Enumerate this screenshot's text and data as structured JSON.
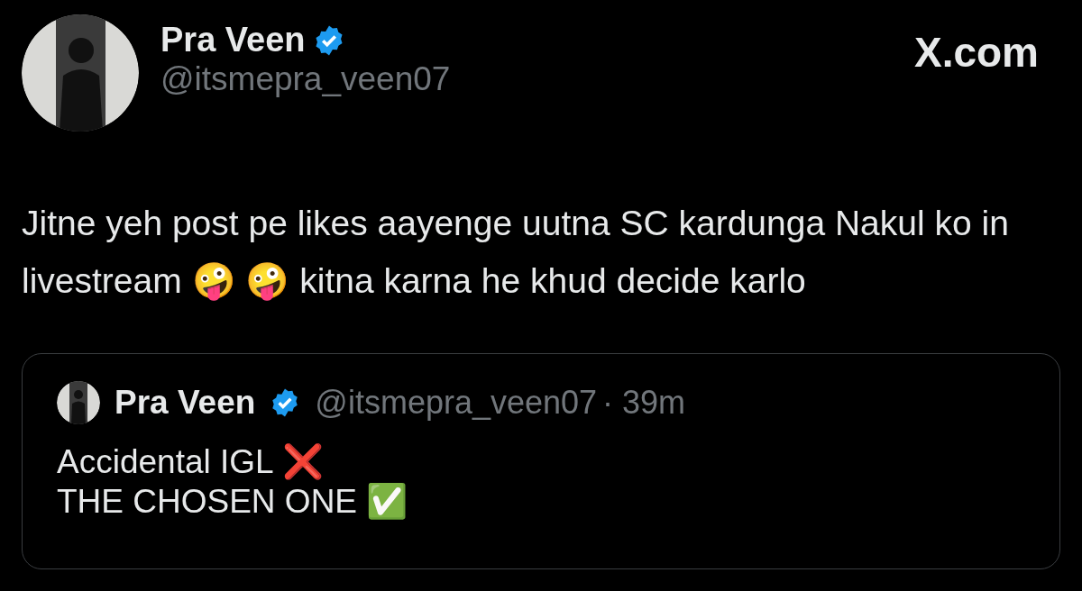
{
  "author": {
    "name": "Pra Veen",
    "verified": true,
    "handle": "@itsmepra_veen07"
  },
  "site": "X.com",
  "text": "Jitne yeh post pe likes aayenge uutna SC kardunga Nakul ko in livestream 🤪 🤪 kitna karna he khud decide karlo",
  "quote": {
    "name": "Pra Veen",
    "verified": true,
    "handle": "@itsmepra_veen07",
    "time": "· 39m",
    "lines": [
      "Accidental IGL ❌",
      "THE CHOSEN ONE ✅"
    ]
  }
}
